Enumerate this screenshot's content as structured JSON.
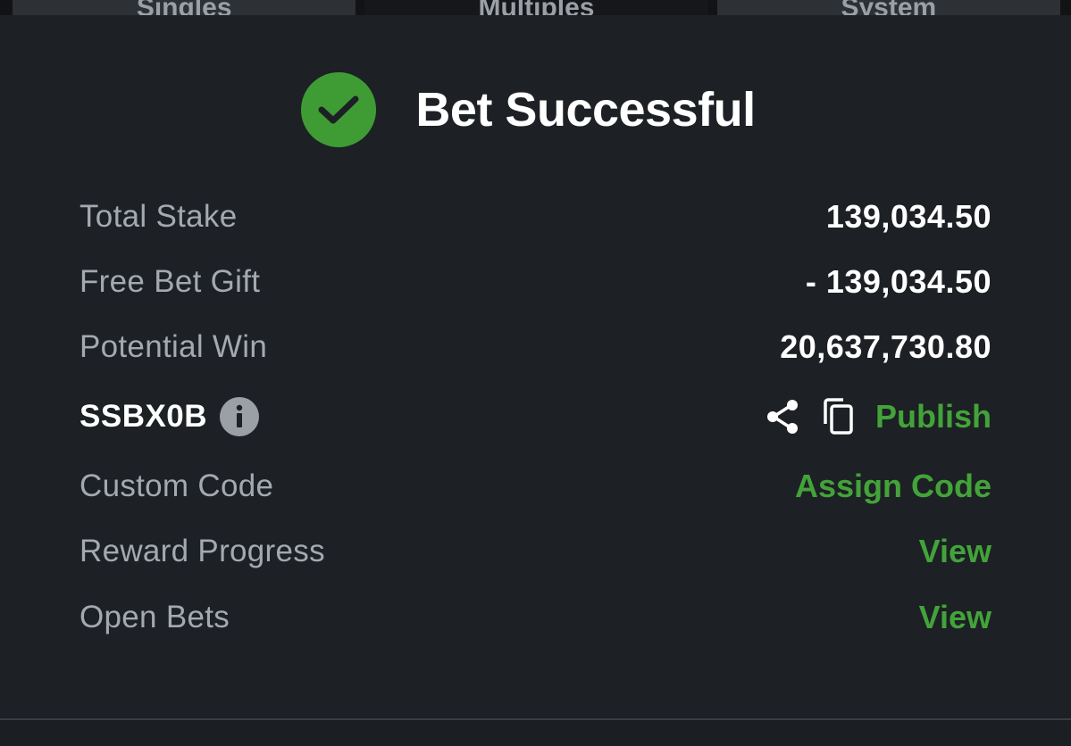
{
  "tabs": [
    {
      "label": "Singles"
    },
    {
      "label": "Multiples"
    },
    {
      "label": "System"
    }
  ],
  "header": {
    "icon": "check-circle-icon",
    "title": "Bet Successful",
    "accent": "#3f9c35"
  },
  "summary": {
    "total_stake": {
      "label": "Total Stake",
      "value": "139,034.50"
    },
    "free_bet": {
      "label": "Free Bet Gift",
      "value": "- 139,034.50"
    },
    "potential_win": {
      "label": "Potential Win",
      "value": "20,637,730.80"
    }
  },
  "booking": {
    "code": "SSBX0B",
    "info_icon": "info-icon",
    "share_icon": "share-icon",
    "copy_icon": "copy-icon",
    "publish_label": "Publish"
  },
  "custom_code": {
    "label": "Custom Code",
    "action": "Assign Code"
  },
  "reward_progress": {
    "label": "Reward Progress",
    "action": "View"
  },
  "open_bets": {
    "label": "Open Bets",
    "action": "View"
  },
  "colors": {
    "background": "#1d2024",
    "link": "#43a33a",
    "label": "#a4a9b1"
  }
}
